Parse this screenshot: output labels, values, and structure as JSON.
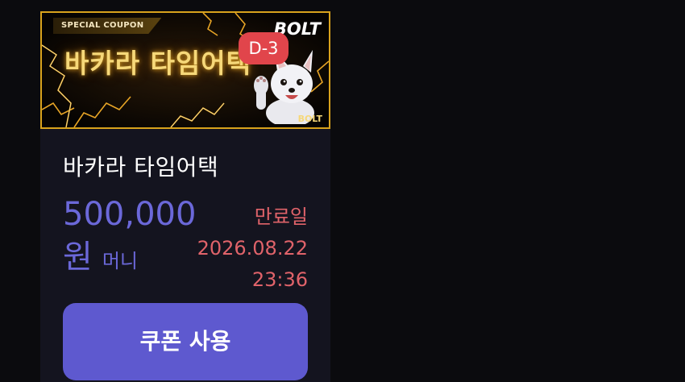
{
  "coupon": {
    "banner": {
      "special_label": "SPECIAL COUPON",
      "title": "바카라 타임어택",
      "brand_logo": "BOLT",
      "brand_small": "BOLT",
      "d_day": "D-3",
      "mascot_icon": "wolf-mascot-icon",
      "frame_color": "#d8a21c"
    },
    "title": "바카라 타임어택",
    "amount": "500,000",
    "currency": "원",
    "money_type": "머니",
    "expiry": {
      "label": "만료일",
      "date": "2026.08.22",
      "time": "23:36"
    },
    "use_button": "쿠폰 사용",
    "colors": {
      "accent": "#6b68d9",
      "button": "#5e59cf",
      "expiry": "#e0636a",
      "badge": "#e1454b"
    }
  }
}
